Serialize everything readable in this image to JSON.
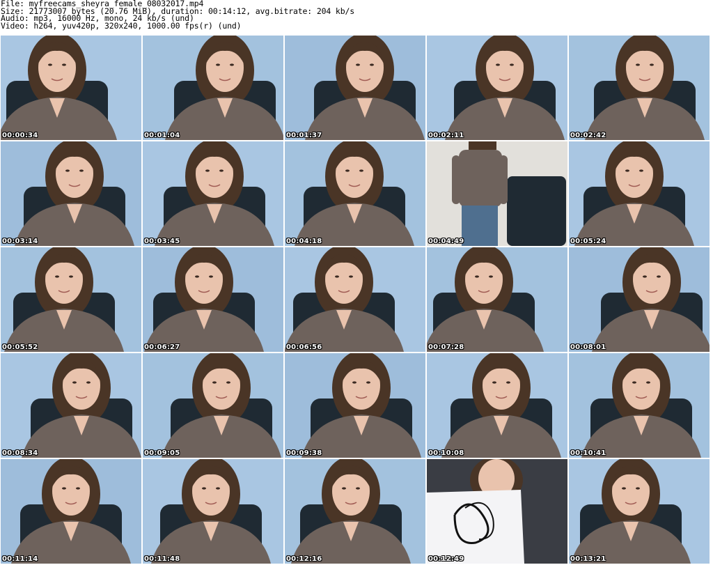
{
  "header": {
    "file_line": "File: myfreecams_sheyra_female_08032017.mp4",
    "size_line": "Size: 21773007 bytes (20.76 MiB), duration: 00:14:12, avg.bitrate: 204 kb/s",
    "audio_line": "Audio: mp3, 16000 Hz, mono, 24 kb/s (und)",
    "video_line": "Video: h264, yuv420p, 320x240, 1000.00 fps(r) (und)"
  },
  "thumbnails": [
    {
      "timestamp": "00:00:34"
    },
    {
      "timestamp": "00:01:04"
    },
    {
      "timestamp": "00:01:37"
    },
    {
      "timestamp": "00:02:11"
    },
    {
      "timestamp": "00:02:42"
    },
    {
      "timestamp": "00:03:14"
    },
    {
      "timestamp": "00:03:45"
    },
    {
      "timestamp": "00:04:18"
    },
    {
      "timestamp": "00:04:49"
    },
    {
      "timestamp": "00:05:24"
    },
    {
      "timestamp": "00:05:52"
    },
    {
      "timestamp": "00:06:27"
    },
    {
      "timestamp": "00:06:56"
    },
    {
      "timestamp": "00:07:28"
    },
    {
      "timestamp": "00:08:01"
    },
    {
      "timestamp": "00:08:34"
    },
    {
      "timestamp": "00:09:05"
    },
    {
      "timestamp": "00:09:38"
    },
    {
      "timestamp": "00:10:08"
    },
    {
      "timestamp": "00:10:41"
    },
    {
      "timestamp": "00:11:14"
    },
    {
      "timestamp": "00:11:48"
    },
    {
      "timestamp": "00:12:16"
    },
    {
      "timestamp": "00:12:49"
    },
    {
      "timestamp": "00:13:21"
    }
  ],
  "colors": {
    "background": "#ffffff",
    "text": "#000000",
    "timestamp_text": "#ffffff",
    "wall": "#a9c6e2",
    "sweater": "#6e625c",
    "hair": "#4a3526",
    "skin": "#e9c3ad",
    "chair": "#1f2a33"
  }
}
